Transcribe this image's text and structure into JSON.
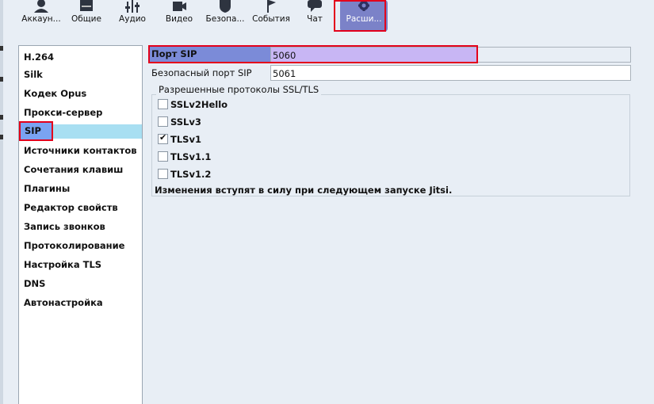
{
  "toolbar": {
    "items": [
      {
        "label": "Аккаун...",
        "icon": "user-icon"
      },
      {
        "label": "Общие",
        "icon": "general-icon"
      },
      {
        "label": "Аудио",
        "icon": "audio-icon"
      },
      {
        "label": "Видео",
        "icon": "video-icon"
      },
      {
        "label": "Безопа...",
        "icon": "security-icon"
      },
      {
        "label": "События",
        "icon": "flag-icon"
      },
      {
        "label": "Чат",
        "icon": "chat-icon"
      },
      {
        "label": "Расши...",
        "icon": "gear-icon"
      }
    ],
    "active": "Расши..."
  },
  "nav": {
    "items": [
      "H.264",
      "Silk",
      "Кодек Opus",
      "Прокси-сервер",
      "SIP",
      "Источники контактов",
      "Сочетания клавиш",
      "Плагины",
      "Редактор свойств",
      "Запись звонков",
      "Протоколирование",
      "Настройка TLS",
      "DNS",
      "Автонастройка"
    ],
    "selected": "SIP"
  },
  "sip": {
    "port_label": "Порт SIP",
    "port_value": "5060",
    "secure_port_label": "Безопасный порт SIP",
    "secure_port_value": "5061",
    "protocols_title": "Разрешенные протоколы SSL/TLS",
    "protocols": [
      {
        "label": "SSLv2Hello",
        "checked": false
      },
      {
        "label": "SSLv3",
        "checked": false
      },
      {
        "label": "TLSv1",
        "checked": true
      },
      {
        "label": "TLSv1.1",
        "checked": false
      },
      {
        "label": "TLSv1.2",
        "checked": false
      }
    ],
    "check_mark": "✔",
    "restart_note": "Изменения вступят в силу при следующем запуске Jitsi."
  },
  "colors": {
    "accent": "#7b82c8",
    "highlight": "#e3001b",
    "selection": "#a8dff2"
  }
}
